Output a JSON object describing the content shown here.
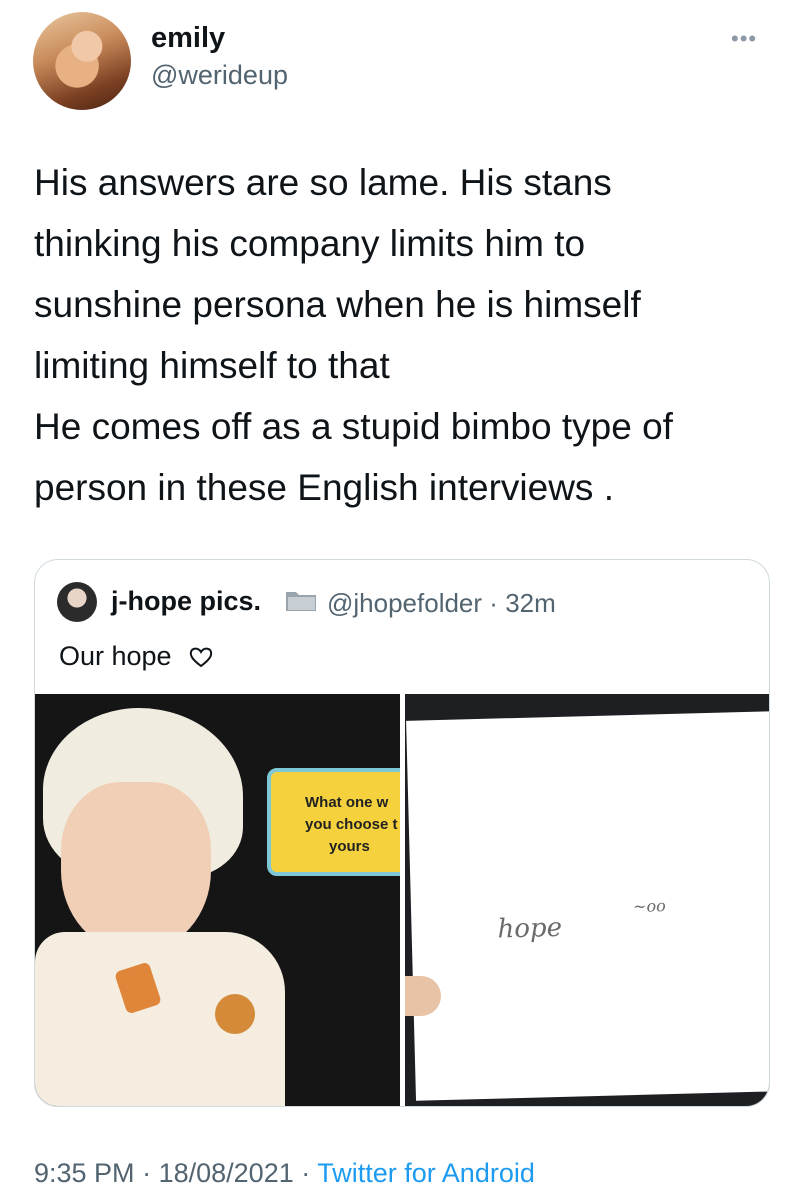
{
  "author": {
    "display_name": "emily",
    "handle": "@werideup"
  },
  "tweet": {
    "text": "His answers are so lame. His stans\nthinking his company limits him to\nsunshine persona when he is himself\nlimiting himself to that\nHe comes off as a stupid bimbo type of\nperson in these English interviews ."
  },
  "quoted_tweet": {
    "display_name": "j-hope pics.",
    "handle": "@jhopefolder",
    "separator": "·",
    "time": "32m",
    "text": "Our hope",
    "caption_box_lines": [
      "What one w",
      "you choose t",
      "yours"
    ],
    "paper_scribble": [
      "hope",
      "~oo"
    ]
  },
  "footer": {
    "time": "9:35 PM",
    "separator": "·",
    "date": "18/08/2021",
    "app": "Twitter for Android"
  },
  "icons": {
    "more": "more-dots-icon",
    "badge": "folder-icon",
    "heart": "heart-outline-icon"
  },
  "colors": {
    "link": "#1d9bf0",
    "secondary_text": "#536471",
    "border": "#cfd9de"
  }
}
